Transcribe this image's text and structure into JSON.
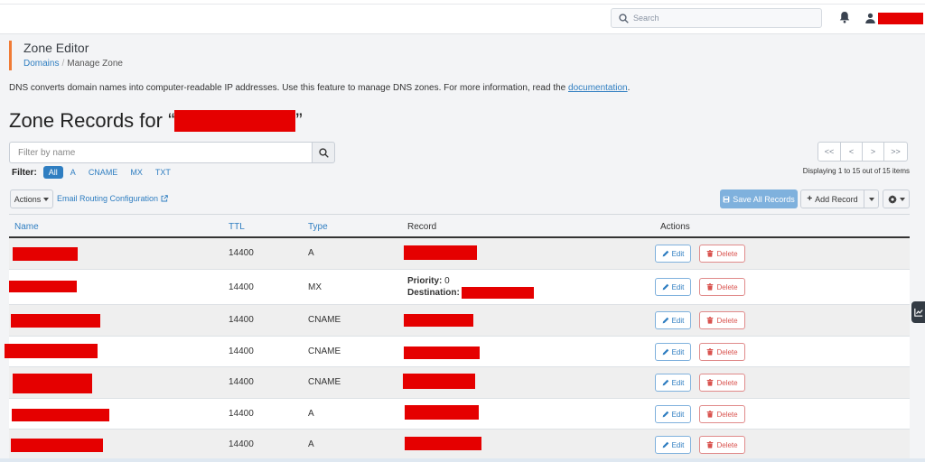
{
  "header": {
    "search_placeholder": "Search"
  },
  "page": {
    "title": "Zone Editor",
    "breadcrumb": {
      "domains": "Domains",
      "separator": "/",
      "current": "Manage Zone"
    },
    "intro_text": "DNS converts domain names into computer-readable IP addresses. Use this feature to manage DNS zones. For more information, read the",
    "intro_link": "documentation",
    "intro_end": ".",
    "heading_prefix": "Zone Records for “",
    "heading_suffix": "”"
  },
  "filter": {
    "placeholder": "Filter by name",
    "label": "Filter:",
    "chips": [
      "All",
      "A",
      "CNAME",
      "MX",
      "TXT"
    ],
    "active": "All"
  },
  "pager": {
    "buttons": [
      "<<",
      "<",
      ">",
      ">>"
    ],
    "displaying": "Displaying 1 to 15 out of 15 items"
  },
  "toolbar": {
    "actions_label": "Actions",
    "email_routing_label": "Email Routing Configuration",
    "save_all_label": "Save All Records",
    "add_record_label": "Add Record"
  },
  "table": {
    "columns": {
      "name": "Name",
      "ttl": "TTL",
      "type": "Type",
      "record": "Record",
      "actions": "Actions"
    },
    "edit_label": "Edit",
    "delete_label": "Delete",
    "rows": [
      {
        "ttl": "14400",
        "type": "A"
      },
      {
        "ttl": "14400",
        "type": "MX",
        "priority_label": "Priority:",
        "priority_value": "0",
        "destination_label": "Destination:"
      },
      {
        "ttl": "14400",
        "type": "CNAME"
      },
      {
        "ttl": "14400",
        "type": "CNAME"
      },
      {
        "ttl": "14400",
        "type": "CNAME"
      },
      {
        "ttl": "14400",
        "type": "A"
      },
      {
        "ttl": "14400",
        "type": "A"
      }
    ]
  },
  "colors": {
    "accent": "#2f7ec1",
    "title_bar_accent": "#f07b35",
    "delete_red": "#d9534f",
    "redaction": "#e50000"
  },
  "icons": [
    "search-icon",
    "bell-icon",
    "user-icon",
    "external-link-icon",
    "save-icon",
    "plus-icon",
    "gear-icon",
    "pencil-icon",
    "trash-icon",
    "chart-icon"
  ]
}
